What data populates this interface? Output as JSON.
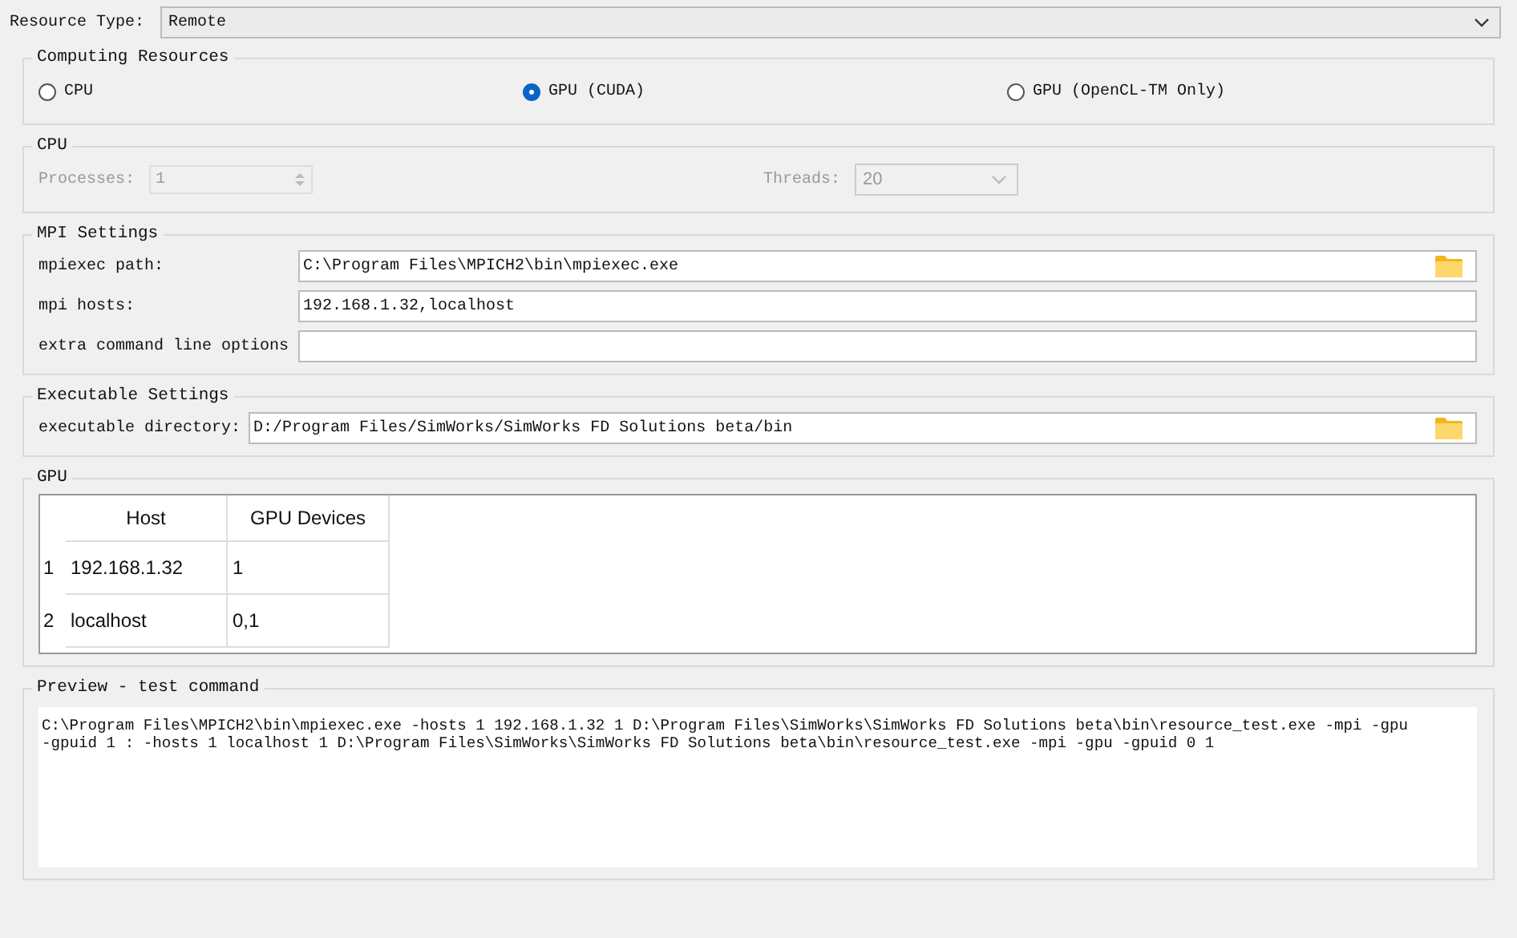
{
  "resource_type": {
    "label": "Resource Type:",
    "value": "Remote"
  },
  "computing_resources": {
    "title": "Computing Resources",
    "options": [
      {
        "label": "CPU",
        "selected": false
      },
      {
        "label": "GPU (CUDA)",
        "selected": true
      },
      {
        "label": "GPU (OpenCL-TM Only)",
        "selected": false
      }
    ]
  },
  "cpu": {
    "title": "CPU",
    "processes": {
      "label": "Processes:",
      "value": "1",
      "disabled": true
    },
    "threads": {
      "label": "Threads:",
      "value": "20",
      "disabled": true
    }
  },
  "mpi_settings": {
    "title": "MPI Settings",
    "fields": [
      {
        "label": "mpiexec path:",
        "value": "C:\\Program Files\\MPICH2\\bin\\mpiexec.exe",
        "kind": "browse"
      },
      {
        "label": "mpi hosts:",
        "value": "192.168.1.32,localhost",
        "kind": "text"
      },
      {
        "label": "extra command line options",
        "kind": "text"
      }
    ]
  },
  "executable_settings": {
    "title": "Executable Settings",
    "fields": [
      {
        "label": "executable directory:",
        "value": "D:/Program Files/SimWorks/SimWorks FD Solutions beta/bin",
        "kind": "browse"
      }
    ]
  },
  "gpu": {
    "title": "GPU",
    "table": {
      "columns": [
        "Host",
        "GPU Devices"
      ],
      "rows": [
        {
          "number": "1",
          "cells": [
            "192.168.1.32",
            "1"
          ]
        },
        {
          "number": "2",
          "cells": [
            "localhost",
            "0,1"
          ]
        }
      ]
    }
  },
  "preview": {
    "title": "Preview - test command",
    "lines": [
      "C:\\Program Files\\MPICH2\\bin\\mpiexec.exe -hosts 1 192.168.1.32 1 D:\\Program Files\\SimWorks\\SimWorks FD Solutions beta\\bin\\resource_test.exe -mpi -gpu",
      "-gpuid 1 : -hosts 1 localhost 1 D:\\Program Files\\SimWorks\\SimWorks FD Solutions beta\\bin\\resource_test.exe -mpi -gpu -gpuid 0 1"
    ]
  }
}
